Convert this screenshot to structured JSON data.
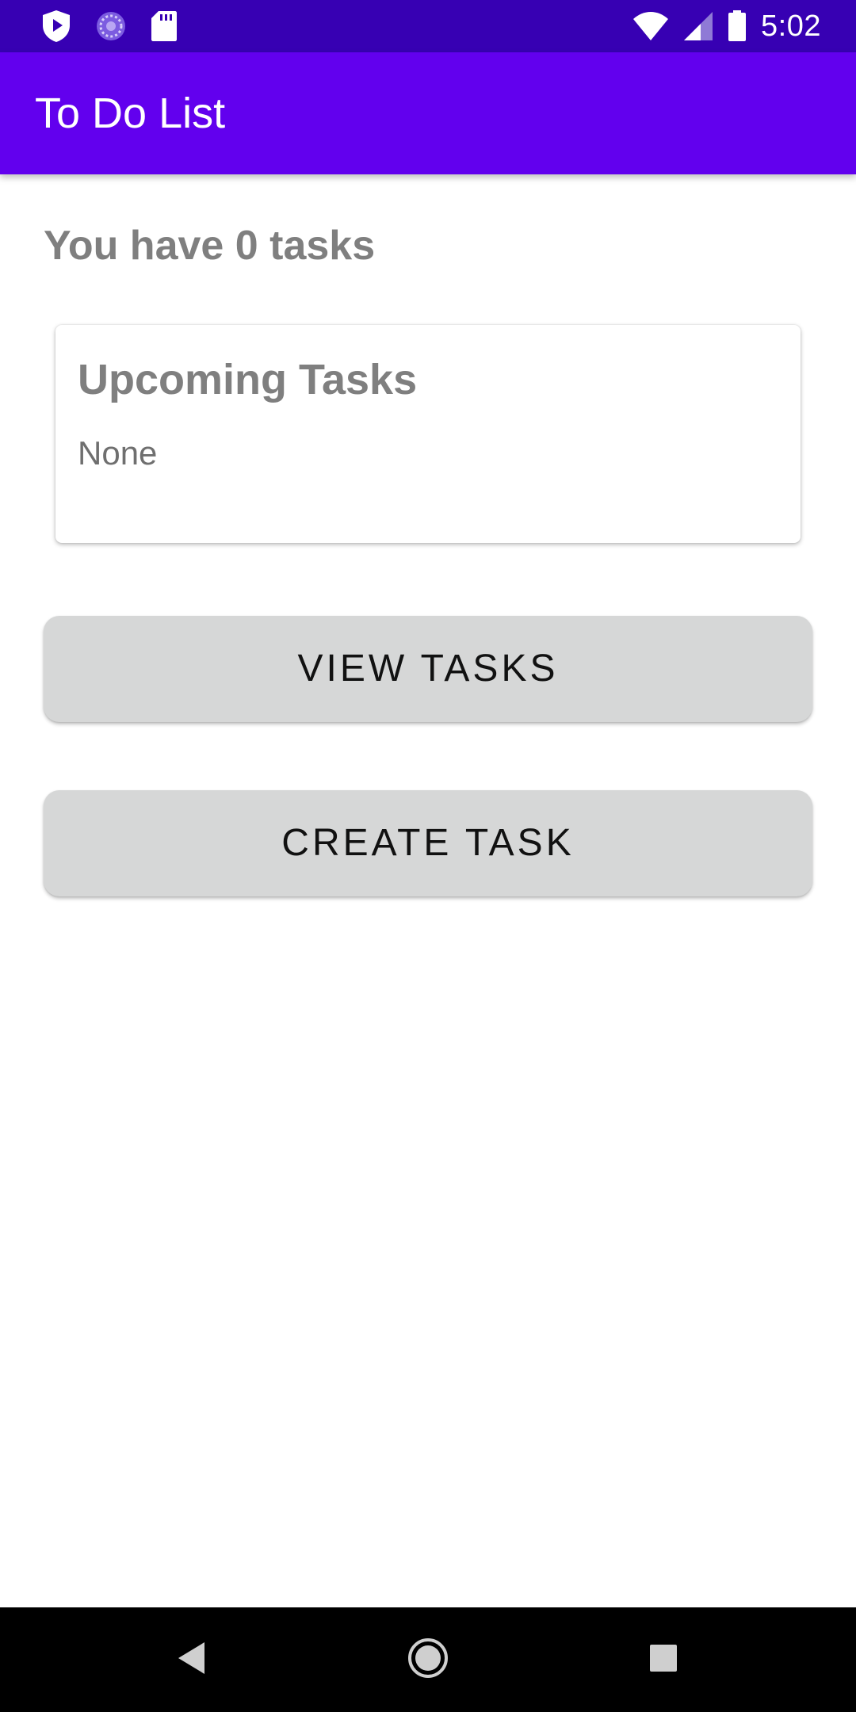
{
  "status_bar": {
    "time": "5:02",
    "left_icons": [
      "shield-icon",
      "sync-icon",
      "sd-card-icon"
    ],
    "right_icons": [
      "wifi-icon",
      "cellular-signal-icon",
      "battery-icon"
    ]
  },
  "app_bar": {
    "title": "To Do List"
  },
  "main": {
    "task_count_text": "You have 0 tasks",
    "upcoming_card": {
      "title": "Upcoming Tasks",
      "body": "None"
    },
    "buttons": {
      "view_tasks_label": "VIEW TASKS",
      "create_task_label": "CREATE TASK"
    }
  },
  "nav_bar": {
    "icons": [
      "back-icon",
      "home-icon",
      "recents-icon"
    ]
  },
  "colors": {
    "status_bar": "#3700b3",
    "app_bar": "#6200ee",
    "button_bg": "#d6d7d7",
    "secondary_text": "#7f7f7f",
    "nav_bar": "#000000"
  }
}
